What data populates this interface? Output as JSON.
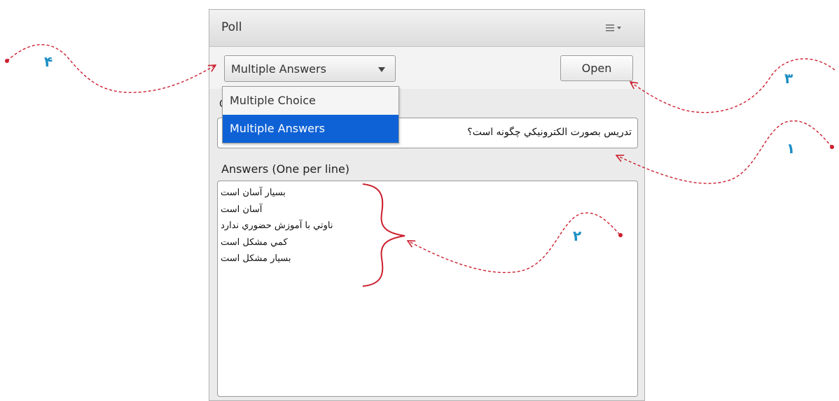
{
  "panel": {
    "title": "Poll",
    "menu_icon": "menu-lines-icon"
  },
  "toolbar": {
    "poll_type_value": "Multiple Answers",
    "open_label": "Open"
  },
  "dropdown": {
    "options": [
      {
        "label": "Multiple Choice",
        "selected": false
      },
      {
        "label": "Multiple Answers",
        "selected": true
      }
    ]
  },
  "question": {
    "label_fragment": "Q",
    "value": "تدریس بصورت الکترونیکي چگونه است؟"
  },
  "answers": {
    "label": "Answers (One per line)",
    "lines": [
      "بسیار آسان است",
      "آسان است",
      "ناوتي با آموزش حضوري ندارد",
      "کمي مشکل است",
      "بسیار مشکل است"
    ]
  },
  "callouts": {
    "c1": "۱",
    "c2": "۲",
    "c3": "۳",
    "c4": "۴"
  },
  "colors": {
    "annotation_red": "#cc1f2f",
    "callout_blue": "#1c8fc4",
    "selected_option": "#0f62d6"
  }
}
